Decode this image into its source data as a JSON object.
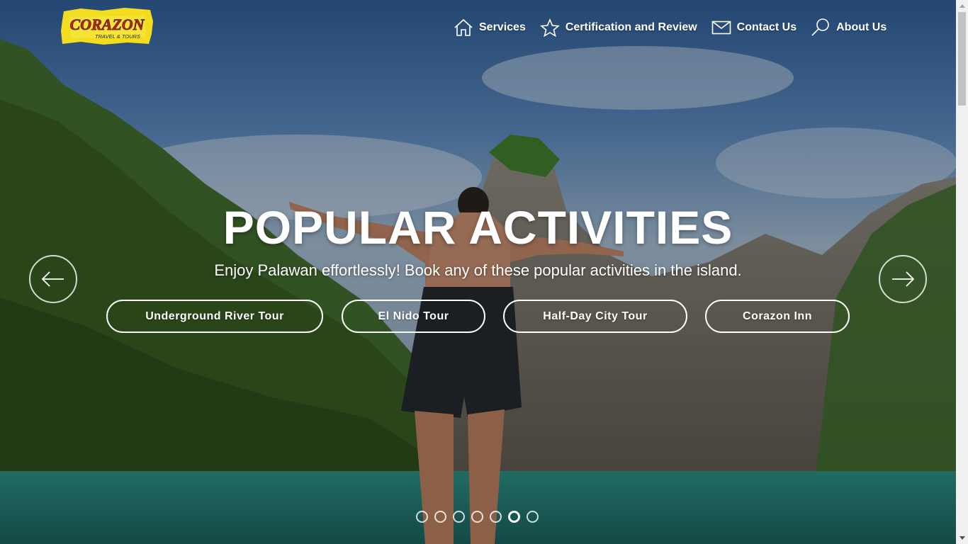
{
  "brand": {
    "logo_main": "CORAZON",
    "logo_sub": "TRAVEL & TOURS"
  },
  "nav": [
    {
      "label": "Services",
      "icon": "home-icon"
    },
    {
      "label": "Certification and Review",
      "icon": "star-icon"
    },
    {
      "label": "Contact Us",
      "icon": "envelope-icon"
    },
    {
      "label": "About Us",
      "icon": "magnifier-icon"
    }
  ],
  "hero": {
    "title": "POPULAR ACTIVITIES",
    "subtitle": "Enjoy Palawan effortlessly! Book any of these popular activities in the island.",
    "buttons": [
      {
        "label": "Underground River Tour"
      },
      {
        "label": "El Nido Tour"
      },
      {
        "label": "Half-Day City Tour"
      },
      {
        "label": "Corazon Inn"
      }
    ]
  },
  "carousel": {
    "slide_count": 7,
    "active_slide": 6
  },
  "colors": {
    "text": "#ffffff",
    "logo_yellow": "#f4dc20",
    "logo_red": "#c8201a"
  }
}
